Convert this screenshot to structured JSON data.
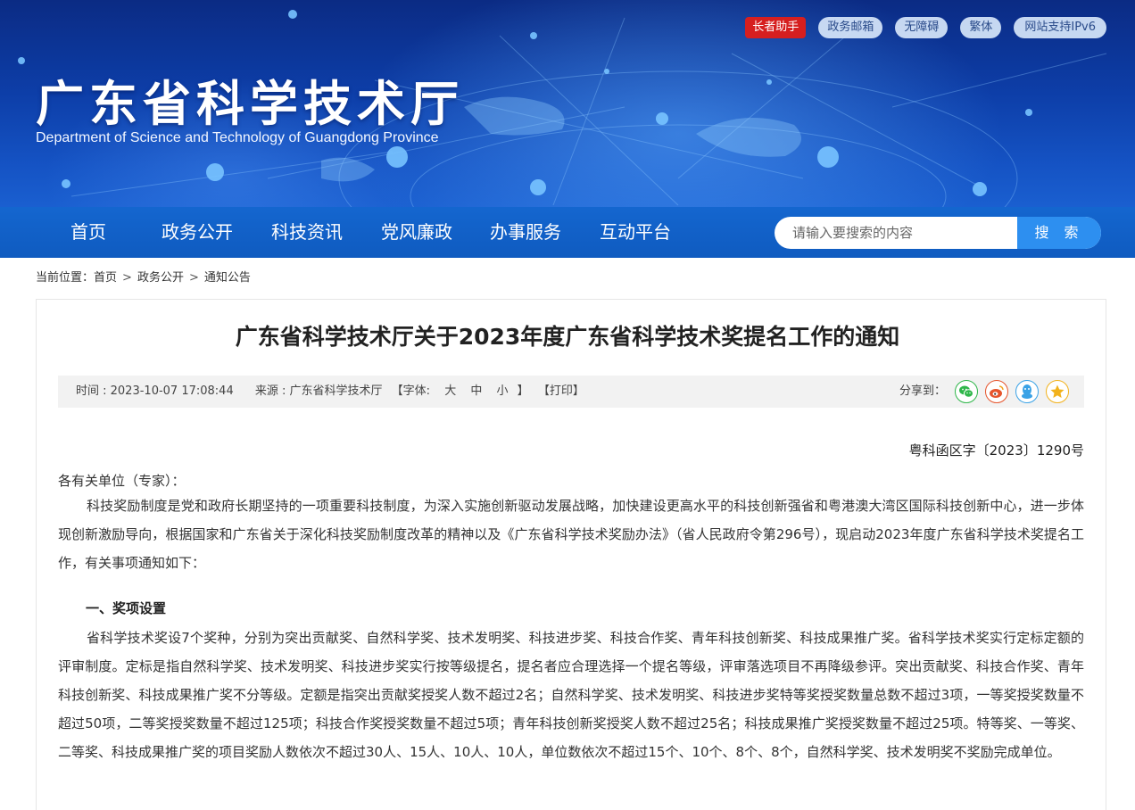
{
  "header": {
    "site_title": "广东省科学技术厅",
    "site_subtitle": "Department of Science and Technology of Guangdong Province",
    "top_links": [
      "长者助手",
      "政务邮箱",
      "无障碍",
      "繁体",
      "网站支持IPv6"
    ]
  },
  "nav": {
    "items": [
      "首页",
      "政务公开",
      "科技资讯",
      "党风廉政",
      "办事服务",
      "互动平台"
    ],
    "search_placeholder": "请输入要搜索的内容",
    "search_button": "搜 索"
  },
  "breadcrumb": {
    "label": "当前位置：",
    "items": [
      "首页",
      "政务公开",
      "通知公告"
    ],
    "separator": ">"
  },
  "article": {
    "title": "广东省科学技术厅关于2023年度广东省科学技术奖提名工作的通知",
    "meta": {
      "time": "时间 : 2023-10-07 17:08:44",
      "source": "来源 : 广东省科学技术厅",
      "font_label": "【字体:",
      "font_sizes": [
        "大",
        "中",
        "小"
      ],
      "font_close": "】",
      "print": "【打印】",
      "share_label": "分享到："
    },
    "doc_number": "粤科函区字〔2023〕1290号",
    "salutation": "各有关单位（专家）：",
    "paragraph1": "科技奖励制度是党和政府长期坚持的一项重要科技制度，为深入实施创新驱动发展战略，加快建设更高水平的科技创新强省和粤港澳大湾区国际科技创新中心，进一步体现创新激励导向，根据国家和广东省关于深化科技奖励制度改革的精神以及《广东省科学技术奖励办法》（省人民政府令第296号），现启动2023年度广东省科学技术奖提名工作，有关事项通知如下：",
    "section1_heading": "一、奖项设置",
    "paragraph2": "省科学技术奖设7个奖种，分别为突出贡献奖、自然科学奖、技术发明奖、科技进步奖、科技合作奖、青年科技创新奖、科技成果推广奖。省科学技术奖实行定标定额的评审制度。定标是指自然科学奖、技术发明奖、科技进步奖实行按等级提名，提名者应合理选择一个提名等级，评审落选项目不再降级参评。突出贡献奖、科技合作奖、青年科技创新奖、科技成果推广奖不分等级。定额是指突出贡献奖授奖人数不超过2名；自然科学奖、技术发明奖、科技进步奖特等奖授奖数量总数不超过3项，一等奖授奖数量不超过50项，二等奖授奖数量不超过125项；科技合作奖授奖数量不超过5项；青年科技创新奖授奖人数不超过25名；科技成果推广奖授奖数量不超过25项。特等奖、一等奖、二等奖、科技成果推广奖的项目奖励人数依次不超过30人、15人、10人、10人，单位数依次不超过15个、10个、8个、8个，自然科学奖、技术发明奖不奖励完成单位。"
  },
  "colors": {
    "nav_blue": "#1466cf",
    "search_button": "#2d8ff0",
    "elder_red": "#d61f1f",
    "wechat": "#2fb64a",
    "weibo": "#e6552d",
    "qq": "#3aa2e6",
    "qzone": "#f2b21c"
  },
  "icons": [
    "wechat-icon",
    "weibo-icon",
    "qq-icon",
    "qzone-icon"
  ]
}
